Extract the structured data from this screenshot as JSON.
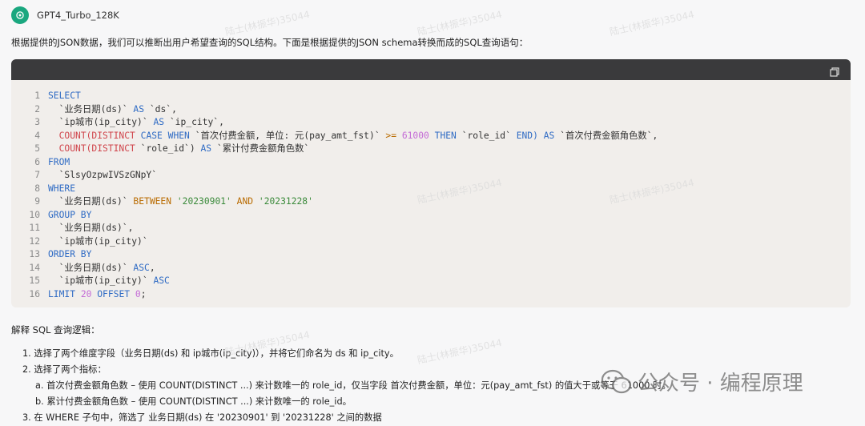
{
  "header": {
    "model_name": "GPT4_Turbo_128K"
  },
  "intro": "根据提供的JSON数据，我们可以推断出用户希望查询的SQL结构。下面是根据提供的JSON schema转换而成的SQL查询语句：",
  "code": {
    "lines": [
      {
        "n": "1"
      },
      {
        "n": "2"
      },
      {
        "n": "3"
      },
      {
        "n": "4"
      },
      {
        "n": "5"
      },
      {
        "n": "6"
      },
      {
        "n": "7"
      },
      {
        "n": "8"
      },
      {
        "n": "9"
      },
      {
        "n": "10"
      },
      {
        "n": "11"
      },
      {
        "n": "12"
      },
      {
        "n": "13"
      },
      {
        "n": "14"
      },
      {
        "n": "15"
      },
      {
        "n": "16"
      }
    ],
    "t": {
      "select": "SELECT",
      "ds_col": "`业务日期(ds)`",
      "as": "AS",
      "ds_alias": "`ds`",
      "city_col": "`ip城市(ip_city)`",
      "city_alias": "`ip_city`",
      "count_distinct": "COUNT(DISTINCT",
      "case_when": "CASE WHEN",
      "pay_col": "`首次付费金额, 单位: 元(pay_amt_fst)`",
      "gte": ">=",
      "num_61000": "61000",
      "then": "THEN",
      "role_id": "`role_id`",
      "end": "END)",
      "alias_first": "`首次付费金额角色数`",
      "alias_total": "`累计付费金额角色数`",
      "from": "FROM",
      "table": "`SlsyOzpwIVSzGNpY`",
      "where": "WHERE",
      "between": "BETWEEN",
      "d1": "'20230901'",
      "and": "AND",
      "d2": "'20231228'",
      "group_by": "GROUP BY",
      "order_by": "ORDER BY",
      "asc": "ASC",
      "limit": "LIMIT",
      "num_20": "20",
      "offset": "OFFSET",
      "num_0": "0"
    }
  },
  "explain": {
    "heading": "解释 SQL 查询逻辑：",
    "item1": "1. 选择了两个维度字段（业务日期(ds) 和 ip城市(ip_city)），并将它们命名为 ds 和 ip_city。",
    "item2": "2. 选择了两个指标：",
    "item2a": "a. 首次付费金额角色数 – 使用 COUNT(DISTINCT ...) 来计数唯一的 role_id，仅当字段 首次付费金额，单位：元(pay_amt_fst) 的值大于或等于 61000 时。",
    "item2b": "b. 累计付费金额角色数 – 使用 COUNT(DISTINCT ...) 来计数唯一的 role_id。",
    "item3": "3. 在 WHERE 子句中，筛选了 业务日期(ds) 在 '20230901' 到 '20231228' 之间的数据"
  },
  "brand": {
    "text": "公众号 · 编程原理"
  },
  "watermark": {
    "text": "陆士(林振华)35044"
  }
}
